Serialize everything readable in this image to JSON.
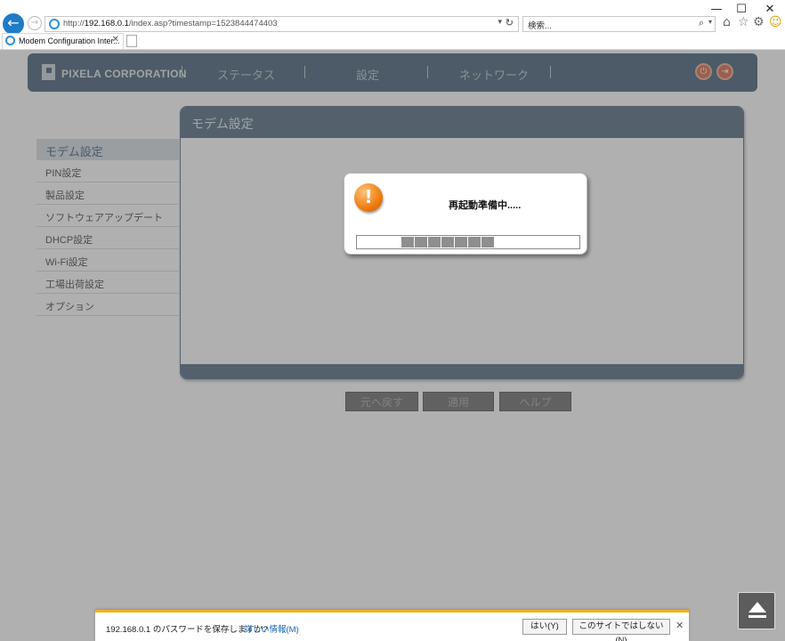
{
  "browser": {
    "url_prefix": "http://",
    "url_host": "192.168.0.1",
    "url_path": "/index.asp?timestamp=1523844474403",
    "search_placeholder": "検索...",
    "tab_title": "Modem Configuration Inter...",
    "minimize": "—",
    "maximize": "☐",
    "close": "✕"
  },
  "header": {
    "logo_text": "PIXELA CORPORATION",
    "nav": [
      "ステータス",
      "設定",
      "ネットワーク"
    ]
  },
  "sidebar": {
    "title": "モデム設定",
    "items": [
      "PIN設定",
      "製品設定",
      "ソフトウェアアップデート",
      "DHCP設定",
      "Wi-Fi設定",
      "工場出荷設定",
      "オプション"
    ]
  },
  "panel": {
    "title": "モデム設定"
  },
  "buttons": {
    "back": "元へ戻す",
    "apply": "適用",
    "help": "ヘルプ"
  },
  "dialog": {
    "message": "再起動準備中.....",
    "icon": "warning-icon",
    "progress_filled_from": 0.2,
    "progress_filled_to": 0.64
  },
  "notification": {
    "message": "192.168.0.1 のパスワードを保存しますか?",
    "link": "詳しい情報(M)",
    "yes": "はい(Y)",
    "not_site": "このサイトではしない(N)",
    "close": "✕"
  },
  "colors": {
    "accent": "#6f8596",
    "warning": "#ef7d0f",
    "notify_bar": "#f2b21b"
  }
}
